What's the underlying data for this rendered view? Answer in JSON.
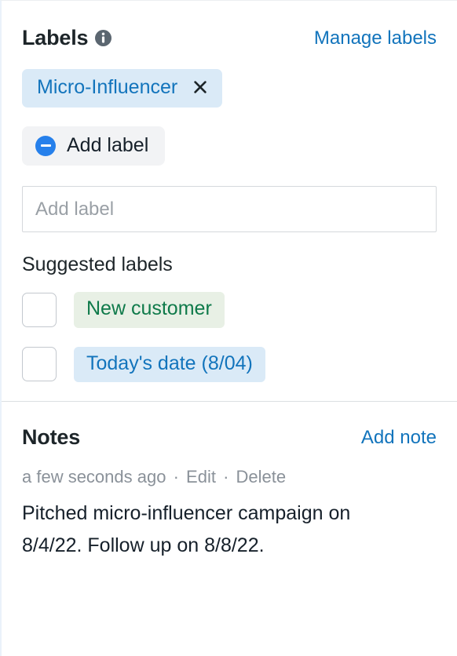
{
  "labels": {
    "title": "Labels",
    "info_icon": "info-icon",
    "manage_link": "Manage labels",
    "applied": [
      {
        "text": "Micro-Influencer",
        "remove_icon": "close-icon",
        "bg": "#daeaf7",
        "fg": "#1274bc"
      }
    ],
    "add_label_button": {
      "label": "Add label",
      "icon": "minus-circle-icon",
      "icon_color": "#2680eb"
    },
    "input": {
      "value": "",
      "placeholder": "Add label"
    },
    "suggested_title": "Suggested labels",
    "suggested": [
      {
        "text": "New customer",
        "checked": false,
        "bg": "#e8f0e5",
        "fg": "#0f7a4a"
      },
      {
        "text": "Today's date (8/04)",
        "checked": false,
        "bg": "#daeaf7",
        "fg": "#1274bc"
      }
    ]
  },
  "notes": {
    "title": "Notes",
    "add_link": "Add note",
    "items": [
      {
        "timestamp": "a few seconds ago",
        "edit_label": "Edit",
        "delete_label": "Delete",
        "separator": "·",
        "body": "Pitched micro-influencer campaign on 8/4/22. Follow up on 8/8/22."
      }
    ]
  },
  "theme": {
    "link_blue": "#1274bc",
    "text_dark": "#16202a",
    "muted_gray": "#8a9199",
    "divider": "#dcdfe2"
  }
}
